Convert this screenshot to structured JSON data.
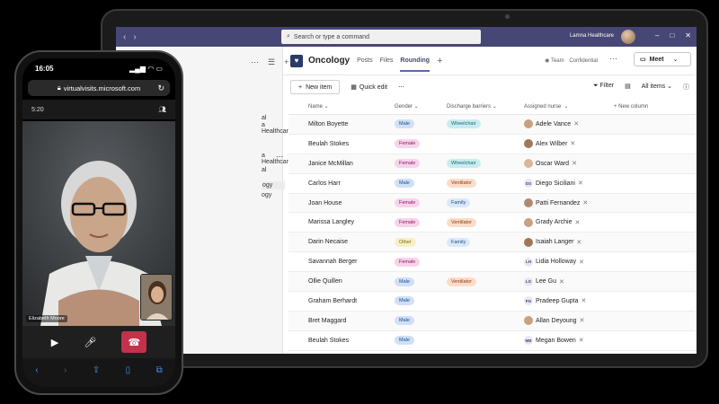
{
  "teams": {
    "search_placeholder": "Search or type a command",
    "org": "Lamna Healthcare",
    "window_controls": [
      "–",
      "□",
      "✕"
    ],
    "left_panel": {
      "lines": [
        "al",
        "a Healthcare",
        "a Healthcare",
        "al",
        "ogy",
        "ogy"
      ]
    },
    "channel": {
      "title": "Oncology",
      "tabs": [
        "Posts",
        "Files",
        "Rounding"
      ],
      "active_tab": "Rounding",
      "team_label": "Team",
      "confidential_label": "Confidential",
      "meet_label": "Meet"
    },
    "toolbar": {
      "new_item": "New item",
      "quick_edit": "Quick edit",
      "filter": "Filter",
      "all_items": "All items"
    },
    "columns": {
      "name": "Name",
      "gender": "Gender",
      "barriers": "Discharge barriers",
      "nurse": "Assigned nurse",
      "new_column": "New column"
    },
    "rows": [
      {
        "name": "Milton Boyette",
        "gender": "Male",
        "barrier": "Wheelchair",
        "nurse": "Adele Vance",
        "nurse_initials": ""
      },
      {
        "name": "Beulah Stokes",
        "gender": "Female",
        "barrier": "",
        "nurse": "Alex Wilber",
        "nurse_initials": ""
      },
      {
        "name": "Janice McMillan",
        "gender": "Female",
        "barrier": "Wheelchair",
        "nurse": "Oscar Ward",
        "nurse_initials": ""
      },
      {
        "name": "Carlos Harr",
        "gender": "Male",
        "barrier": "Ventilator",
        "nurse": "Diego Siciliani",
        "nurse_initials": "DS"
      },
      {
        "name": "Joan House",
        "gender": "Female",
        "barrier": "Family",
        "nurse": "Patti Fernandez",
        "nurse_initials": ""
      },
      {
        "name": "Marissa Langley",
        "gender": "Female",
        "barrier": "Ventilator",
        "nurse": "Grady Archie",
        "nurse_initials": ""
      },
      {
        "name": "Darin Necaise",
        "gender": "Other",
        "barrier": "Family",
        "nurse": "Isaiah Langer",
        "nurse_initials": ""
      },
      {
        "name": "Savannah Berger",
        "gender": "Female",
        "barrier": "",
        "nurse": "Lidia Holloway",
        "nurse_initials": "LH"
      },
      {
        "name": "Ollie Quillen",
        "gender": "Male",
        "barrier": "Ventilator",
        "nurse": "Lee Gu",
        "nurse_initials": "LG"
      },
      {
        "name": "Graham Berhardt",
        "gender": "Male",
        "barrier": "",
        "nurse": "Pradeep Gupta",
        "nurse_initials": "PG"
      },
      {
        "name": "Bret Maggard",
        "gender": "Male",
        "barrier": "",
        "nurse": "Allan Deyoung",
        "nurse_initials": ""
      },
      {
        "name": "Beulah Stokes",
        "gender": "Male",
        "barrier": "",
        "nurse": "Megan Bowen",
        "nurse_initials": "MB"
      }
    ],
    "colors": {
      "titlebar": "#464775",
      "accent": "#6264a7"
    }
  },
  "phone": {
    "time": "16:05",
    "url": "virtualvisits.microsoft.com",
    "call_time": "5:20",
    "caller_name": "Elizabeth Moore",
    "hangup_color": "#c4314b"
  }
}
